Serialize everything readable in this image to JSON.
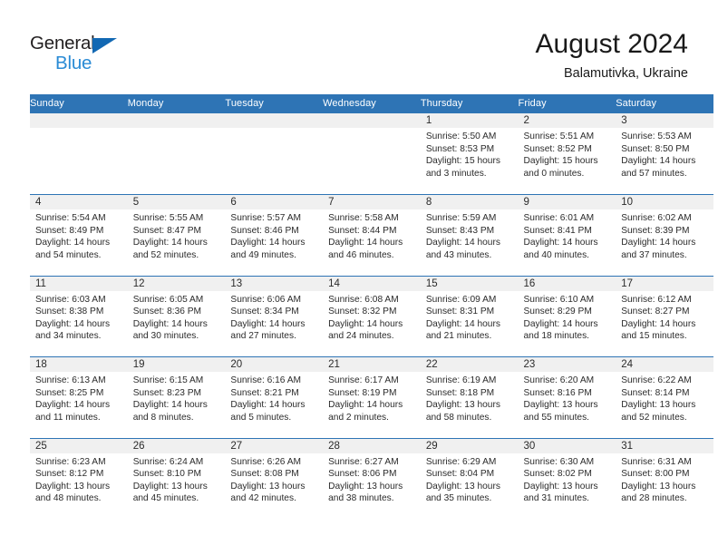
{
  "brand": {
    "logo_line1": "General",
    "logo_line2": "Blue",
    "triangle_icon": "blue-triangle-icon",
    "color_dark": "#221f20",
    "color_blue": "#2a8bd5"
  },
  "header": {
    "title": "August 2024",
    "subtitle": "Balamutivka, Ukraine"
  },
  "theme": {
    "header_band": "#2e74b5",
    "daynum_band": "#f0f0f0",
    "text": "#2b2b2b"
  },
  "weekday_headers": [
    "Sunday",
    "Monday",
    "Tuesday",
    "Wednesday",
    "Thursday",
    "Friday",
    "Saturday"
  ],
  "labels": {
    "sunrise_prefix": "Sunrise:",
    "sunset_prefix": "Sunset:",
    "daylight_prefix": "Daylight:"
  },
  "weeks": [
    [
      {
        "day": "",
        "empty": true
      },
      {
        "day": "",
        "empty": true
      },
      {
        "day": "",
        "empty": true
      },
      {
        "day": "",
        "empty": true
      },
      {
        "day": "1",
        "sunrise": "Sunrise: 5:50 AM",
        "sunset": "Sunset: 8:53 PM",
        "daylight_1": "Daylight: 15 hours",
        "daylight_2": "and 3 minutes."
      },
      {
        "day": "2",
        "sunrise": "Sunrise: 5:51 AM",
        "sunset": "Sunset: 8:52 PM",
        "daylight_1": "Daylight: 15 hours",
        "daylight_2": "and 0 minutes."
      },
      {
        "day": "3",
        "sunrise": "Sunrise: 5:53 AM",
        "sunset": "Sunset: 8:50 PM",
        "daylight_1": "Daylight: 14 hours",
        "daylight_2": "and 57 minutes."
      }
    ],
    [
      {
        "day": "4",
        "sunrise": "Sunrise: 5:54 AM",
        "sunset": "Sunset: 8:49 PM",
        "daylight_1": "Daylight: 14 hours",
        "daylight_2": "and 54 minutes."
      },
      {
        "day": "5",
        "sunrise": "Sunrise: 5:55 AM",
        "sunset": "Sunset: 8:47 PM",
        "daylight_1": "Daylight: 14 hours",
        "daylight_2": "and 52 minutes."
      },
      {
        "day": "6",
        "sunrise": "Sunrise: 5:57 AM",
        "sunset": "Sunset: 8:46 PM",
        "daylight_1": "Daylight: 14 hours",
        "daylight_2": "and 49 minutes."
      },
      {
        "day": "7",
        "sunrise": "Sunrise: 5:58 AM",
        "sunset": "Sunset: 8:44 PM",
        "daylight_1": "Daylight: 14 hours",
        "daylight_2": "and 46 minutes."
      },
      {
        "day": "8",
        "sunrise": "Sunrise: 5:59 AM",
        "sunset": "Sunset: 8:43 PM",
        "daylight_1": "Daylight: 14 hours",
        "daylight_2": "and 43 minutes."
      },
      {
        "day": "9",
        "sunrise": "Sunrise: 6:01 AM",
        "sunset": "Sunset: 8:41 PM",
        "daylight_1": "Daylight: 14 hours",
        "daylight_2": "and 40 minutes."
      },
      {
        "day": "10",
        "sunrise": "Sunrise: 6:02 AM",
        "sunset": "Sunset: 8:39 PM",
        "daylight_1": "Daylight: 14 hours",
        "daylight_2": "and 37 minutes."
      }
    ],
    [
      {
        "day": "11",
        "sunrise": "Sunrise: 6:03 AM",
        "sunset": "Sunset: 8:38 PM",
        "daylight_1": "Daylight: 14 hours",
        "daylight_2": "and 34 minutes."
      },
      {
        "day": "12",
        "sunrise": "Sunrise: 6:05 AM",
        "sunset": "Sunset: 8:36 PM",
        "daylight_1": "Daylight: 14 hours",
        "daylight_2": "and 30 minutes."
      },
      {
        "day": "13",
        "sunrise": "Sunrise: 6:06 AM",
        "sunset": "Sunset: 8:34 PM",
        "daylight_1": "Daylight: 14 hours",
        "daylight_2": "and 27 minutes."
      },
      {
        "day": "14",
        "sunrise": "Sunrise: 6:08 AM",
        "sunset": "Sunset: 8:32 PM",
        "daylight_1": "Daylight: 14 hours",
        "daylight_2": "and 24 minutes."
      },
      {
        "day": "15",
        "sunrise": "Sunrise: 6:09 AM",
        "sunset": "Sunset: 8:31 PM",
        "daylight_1": "Daylight: 14 hours",
        "daylight_2": "and 21 minutes."
      },
      {
        "day": "16",
        "sunrise": "Sunrise: 6:10 AM",
        "sunset": "Sunset: 8:29 PM",
        "daylight_1": "Daylight: 14 hours",
        "daylight_2": "and 18 minutes."
      },
      {
        "day": "17",
        "sunrise": "Sunrise: 6:12 AM",
        "sunset": "Sunset: 8:27 PM",
        "daylight_1": "Daylight: 14 hours",
        "daylight_2": "and 15 minutes."
      }
    ],
    [
      {
        "day": "18",
        "sunrise": "Sunrise: 6:13 AM",
        "sunset": "Sunset: 8:25 PM",
        "daylight_1": "Daylight: 14 hours",
        "daylight_2": "and 11 minutes."
      },
      {
        "day": "19",
        "sunrise": "Sunrise: 6:15 AM",
        "sunset": "Sunset: 8:23 PM",
        "daylight_1": "Daylight: 14 hours",
        "daylight_2": "and 8 minutes."
      },
      {
        "day": "20",
        "sunrise": "Sunrise: 6:16 AM",
        "sunset": "Sunset: 8:21 PM",
        "daylight_1": "Daylight: 14 hours",
        "daylight_2": "and 5 minutes."
      },
      {
        "day": "21",
        "sunrise": "Sunrise: 6:17 AM",
        "sunset": "Sunset: 8:19 PM",
        "daylight_1": "Daylight: 14 hours",
        "daylight_2": "and 2 minutes."
      },
      {
        "day": "22",
        "sunrise": "Sunrise: 6:19 AM",
        "sunset": "Sunset: 8:18 PM",
        "daylight_1": "Daylight: 13 hours",
        "daylight_2": "and 58 minutes."
      },
      {
        "day": "23",
        "sunrise": "Sunrise: 6:20 AM",
        "sunset": "Sunset: 8:16 PM",
        "daylight_1": "Daylight: 13 hours",
        "daylight_2": "and 55 minutes."
      },
      {
        "day": "24",
        "sunrise": "Sunrise: 6:22 AM",
        "sunset": "Sunset: 8:14 PM",
        "daylight_1": "Daylight: 13 hours",
        "daylight_2": "and 52 minutes."
      }
    ],
    [
      {
        "day": "25",
        "sunrise": "Sunrise: 6:23 AM",
        "sunset": "Sunset: 8:12 PM",
        "daylight_1": "Daylight: 13 hours",
        "daylight_2": "and 48 minutes."
      },
      {
        "day": "26",
        "sunrise": "Sunrise: 6:24 AM",
        "sunset": "Sunset: 8:10 PM",
        "daylight_1": "Daylight: 13 hours",
        "daylight_2": "and 45 minutes."
      },
      {
        "day": "27",
        "sunrise": "Sunrise: 6:26 AM",
        "sunset": "Sunset: 8:08 PM",
        "daylight_1": "Daylight: 13 hours",
        "daylight_2": "and 42 minutes."
      },
      {
        "day": "28",
        "sunrise": "Sunrise: 6:27 AM",
        "sunset": "Sunset: 8:06 PM",
        "daylight_1": "Daylight: 13 hours",
        "daylight_2": "and 38 minutes."
      },
      {
        "day": "29",
        "sunrise": "Sunrise: 6:29 AM",
        "sunset": "Sunset: 8:04 PM",
        "daylight_1": "Daylight: 13 hours",
        "daylight_2": "and 35 minutes."
      },
      {
        "day": "30",
        "sunrise": "Sunrise: 6:30 AM",
        "sunset": "Sunset: 8:02 PM",
        "daylight_1": "Daylight: 13 hours",
        "daylight_2": "and 31 minutes."
      },
      {
        "day": "31",
        "sunrise": "Sunrise: 6:31 AM",
        "sunset": "Sunset: 8:00 PM",
        "daylight_1": "Daylight: 13 hours",
        "daylight_2": "and 28 minutes."
      }
    ]
  ]
}
